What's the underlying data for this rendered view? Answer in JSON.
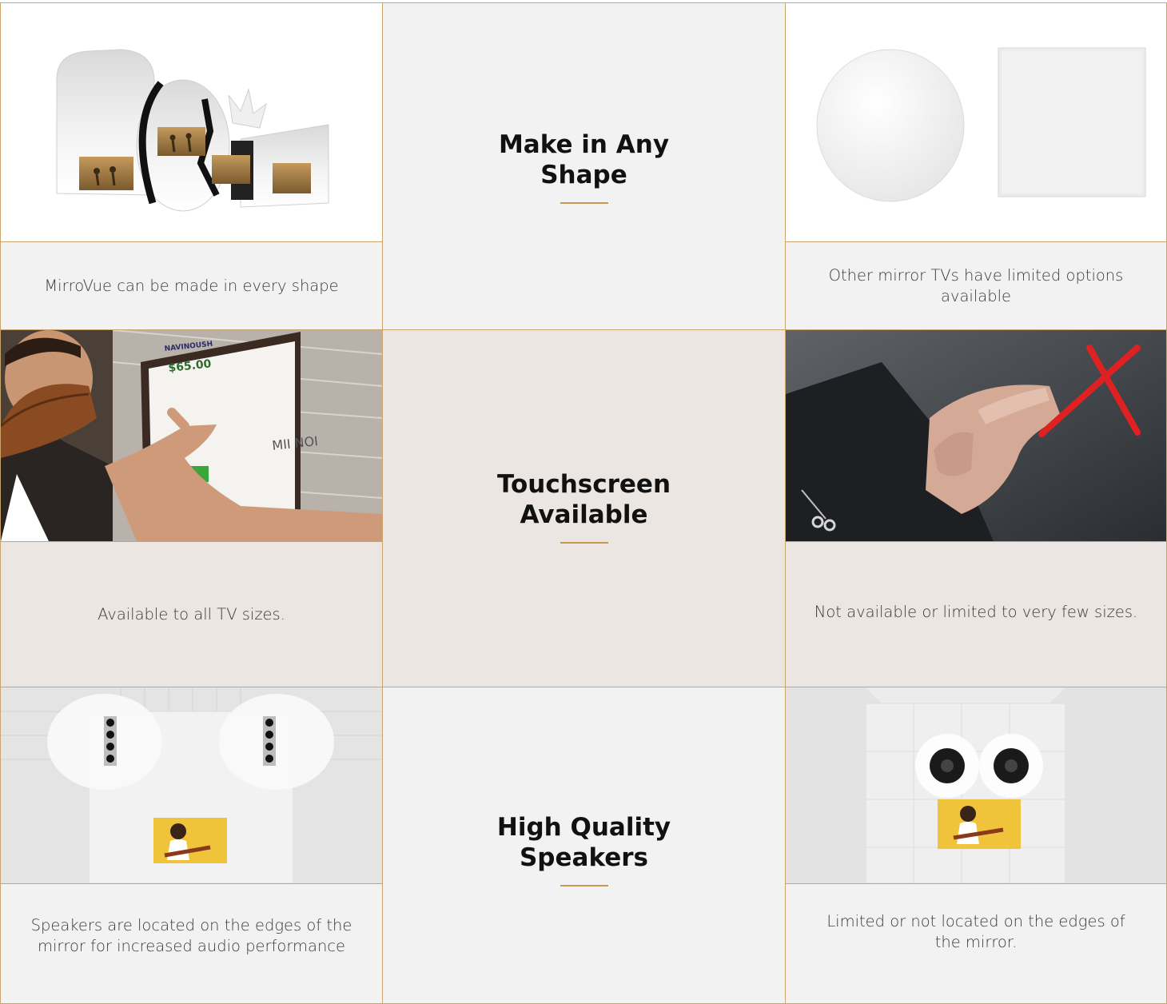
{
  "colors": {
    "border": "#c9a56b",
    "accent": "#c49a52",
    "light_bg": "#f2f2f2",
    "beige_bg": "#ebe6e1"
  },
  "rows": [
    {
      "feature": "Make in Any Shape",
      "mirrovue_caption": "MirroVue can be made in every shape",
      "other_caption": "Other mirror TVs have limited options available",
      "mirrovue_image": "assorted-shaped-mirror-tvs",
      "other_image": "round-and-square-mirrors"
    },
    {
      "feature": "Touchscreen Available",
      "mirrovue_caption": "Available to all TV sizes.",
      "other_caption": "Not available or limited to very few sizes.",
      "mirrovue_image": "man-touching-mirror-touchscreen",
      "other_image": "finger-touch-crossed-out",
      "touchscreen_screen": {
        "brand": "NAVINOUSH",
        "price": "$65.00",
        "side_text": "MII NOI"
      }
    },
    {
      "feature": "High Quality Speakers",
      "mirrovue_caption": "Speakers are located on the edges of the mirror for increased audio performance",
      "other_caption": "Limited or not located on the edges of the mirror.",
      "mirrovue_image": "mirror-with-edge-speakers",
      "other_image": "mirror-with-center-speakers"
    }
  ]
}
